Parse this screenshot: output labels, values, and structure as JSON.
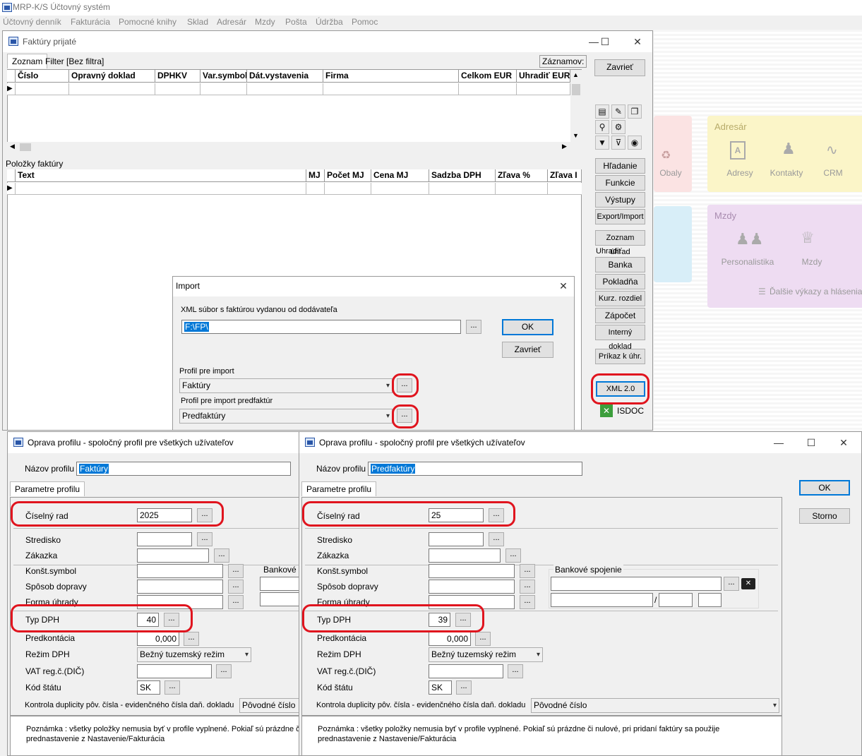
{
  "app": {
    "title": "MRP-K/S Účtovný systém",
    "menu": [
      "Účtovný denník",
      "Fakturácia",
      "Pomocné knihy",
      "Sklad",
      "Adresár",
      "Mzdy",
      "Pošta",
      "Údržba",
      "Pomoc"
    ]
  },
  "desktop": {
    "adresar": {
      "title": "Adresár",
      "items": [
        "Adresy",
        "Kontakty",
        "CRM"
      ]
    },
    "mzdy": {
      "title": "Mzdy",
      "items": [
        "Personalistika",
        "Mzdy"
      ],
      "footer": "Ďalšie výkazy a hlásenia"
    },
    "obaly": "Obaly"
  },
  "invoices": {
    "title": "Faktúry prijaté",
    "tabs": [
      "Zoznam",
      "Filter [Bez filtra]"
    ],
    "records_label": "Záznamov:",
    "columns": [
      "Číslo",
      "Opravný doklad",
      "DPHKV",
      "Var.symbol",
      "Dát.vystavenia",
      "Firma",
      "Celkom EUR",
      "Uhradiť EUR"
    ],
    "items_label": "Položky faktúry",
    "item_columns": [
      "Text",
      "MJ",
      "Počet MJ",
      "Cena MJ",
      "Sadzba DPH",
      "Zľava %",
      "Zľava I"
    ],
    "close_button": "Zavrieť",
    "side_buttons": [
      "Hľadanie",
      "Funkcie",
      "Výstupy",
      "Export/Import",
      "Zoznam úhrad"
    ],
    "pay_label": "Uhradiť",
    "pay_buttons": [
      "Banka",
      "Pokladňa",
      "Kurz. rozdiel",
      "Zápočet",
      "Interný doklad"
    ],
    "order_button": "Príkaz k úhr.",
    "xml_button": "XML 2.0",
    "isdoc_button": "ISDOC"
  },
  "import_dialog": {
    "title": "Import",
    "file_label": "XML súbor s faktúrou vydanou od dodávateľa",
    "file_value": "F:\\FP\\",
    "ok": "OK",
    "cancel": "Zavrieť",
    "profile_label": "Profil pre import",
    "profile_value": "Faktúry",
    "profile2_label": "Profil pre import predfaktúr",
    "profile2_value": "Predfaktúry",
    "dots": "..."
  },
  "profile_left": {
    "title": "Oprava profilu - spoločný profil pre všetkých užívateľov",
    "name_label": "Názov profilu",
    "name_value": "Faktúry",
    "tab": "Parametre profilu",
    "ciselny_rad_label": "Číselný rad",
    "ciselny_rad": "2025",
    "stredisko": "Stredisko",
    "zakazka": "Zákazka",
    "konst_symbol": "Konšt.symbol",
    "sposob_dopravy": "Spôsob dopravy",
    "forma_uhrady": "Forma úhrady",
    "typ_dph_label": "Typ DPH",
    "typ_dph": "40",
    "predkontacia": "Predkontácia",
    "predkontacia_value": "0,000",
    "rezim_label": "Režim DPH",
    "rezim_value": "Bežný tuzemský režim",
    "vat_label": "VAT reg.č.(DIČ)",
    "kod_statu_label": "Kód štátu",
    "kod_statu": "SK",
    "bankove": "Bankové s",
    "kontrola_label": "Kontrola duplicity pôv. čísla - evidenčného čísla daň. dokladu",
    "kontrola_value": "Pôvodné číslo",
    "note": "Poznámka : všetky položky nemusia byť v profile vyplnené. Pokiaľ sú prázdne či n",
    "note2": "prednastavenie z Nastavenie/Fakturácia"
  },
  "profile_right": {
    "title": "Oprava profilu - spoločný profil pre všetkých užívateľov",
    "name_label": "Názov profilu",
    "name_value": "Predfaktúry",
    "tab": "Parametre profilu",
    "ciselny_rad_label": "Číselný rad",
    "ciselny_rad": "25",
    "stredisko": "Stredisko",
    "zakazka": "Zákazka",
    "konst_symbol": "Konšt.symbol",
    "sposob_dopravy": "Spôsob dopravy",
    "forma_uhrady": "Forma úhrady",
    "typ_dph_label": "Typ DPH",
    "typ_dph": "39",
    "predkontacia": "Predkontácia",
    "predkontacia_value": "0,000",
    "rezim_label": "Režim DPH",
    "rezim_value": "Bežný tuzemský režim",
    "vat_label": "VAT reg.č.(DIČ)",
    "kod_statu_label": "Kód štátu",
    "kod_statu": "SK",
    "bankove": "Bankové spojenie",
    "kontrola_label": "Kontrola duplicity pôv. čísla - evidenčného čísla daň. dokladu",
    "kontrola_value": "Pôvodné číslo",
    "note": "Poznámka : všetky položky nemusia byť v profile vyplnené. Pokiaľ sú prázdne či nulové, pri pridaní faktúry sa použije",
    "note2": "prednastavenie z Nastavenie/Fakturácia",
    "ok": "OK",
    "storno": "Storno"
  }
}
